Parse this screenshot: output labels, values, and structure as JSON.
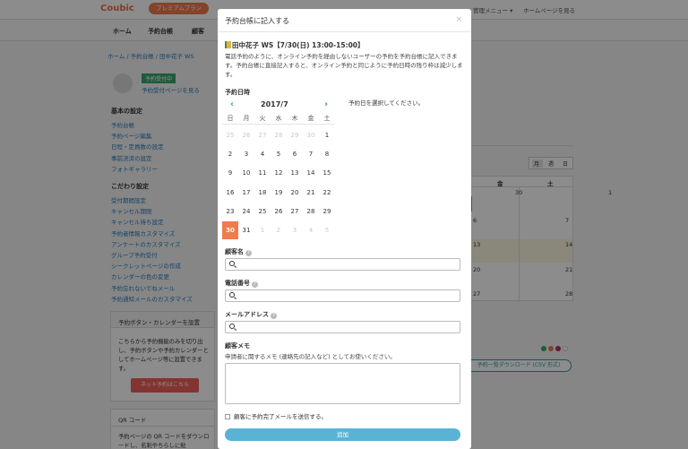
{
  "app": {
    "logo": "Coubic",
    "plan_badge": "プレミアムプラン",
    "menu": "管理メニュー ▾",
    "homepage": "ホームページを見る"
  },
  "nav": {
    "home": "ホーム",
    "reservation_book": "予約台帳",
    "customers": "顧客"
  },
  "breadcrumb": "ホーム / 予約台帳 / 田中花子 WS",
  "sidebar": {
    "status_badge": "予約受付中",
    "view_page": "予約受付ページを見る",
    "basic_title": "基本の設定",
    "basic_items": [
      "予約台帳",
      "予約ページ編集",
      "日程・定員数の設定",
      "事前決済の設定",
      "フォトギャラリー"
    ],
    "custom_title": "こだわり設定",
    "custom_items": [
      "受付期間設定",
      "キャンセル期限",
      "キャンセル待ち設定",
      "予約者情報カスタマイズ",
      "アンケートのカスタマイズ",
      "グループ予約受付",
      "シークレットページの作成",
      "カレンダーの色の変更",
      "予約忘れないでねメール",
      "予約通知メールのカスタマイズ"
    ],
    "widget_title": "予約ボタン・カレンダーを設置",
    "widget_text": "こちらから予約機能のみを切り出し、予約ボタンや予約カレンダーとしてホームページ等に設置できます。",
    "widget_button": "ネット予約はこちら",
    "qr_title": "QR コード",
    "qr_text": "予約ページの QR コードをダウンロードし、名刺やちらしに貼"
  },
  "bg_calendar": {
    "views": [
      "月",
      "週",
      "日"
    ],
    "days": [
      "金",
      "土"
    ],
    "nums": [
      "30",
      "1",
      "6",
      "7",
      "13",
      "14",
      "20",
      "21",
      "27",
      "28",
      "3",
      "4"
    ],
    "csv": "予約一覧ダウンロード (CSV 形式)"
  },
  "modal": {
    "title": "予約台帳に記入する",
    "close": "×",
    "event": "田中花子 WS【7/30(日) 13:00-15:00】",
    "description": "電話予約のように、オンライン予約を経由しないユーザーの予約を予約台帳に記入できます。予約台帳に直接記入すると、オンライン予約と同じように予約日時の残り枠は減少します。",
    "date_label": "予約日時",
    "month": "2017/7",
    "prev": "‹",
    "next": "›",
    "weekdays": [
      "日",
      "月",
      "火",
      "水",
      "木",
      "金",
      "土"
    ],
    "weeks": [
      [
        {
          "d": "25",
          "off": true
        },
        {
          "d": "26",
          "off": true
        },
        {
          "d": "27",
          "off": true
        },
        {
          "d": "28",
          "off": true
        },
        {
          "d": "29",
          "off": true
        },
        {
          "d": "30",
          "off": true
        },
        {
          "d": "1",
          "off": false
        }
      ],
      [
        {
          "d": "2"
        },
        {
          "d": "3"
        },
        {
          "d": "4"
        },
        {
          "d": "5"
        },
        {
          "d": "6"
        },
        {
          "d": "7"
        },
        {
          "d": "8"
        }
      ],
      [
        {
          "d": "9"
        },
        {
          "d": "10"
        },
        {
          "d": "11"
        },
        {
          "d": "12"
        },
        {
          "d": "13"
        },
        {
          "d": "14"
        },
        {
          "d": "15"
        }
      ],
      [
        {
          "d": "16"
        },
        {
          "d": "17"
        },
        {
          "d": "18"
        },
        {
          "d": "19"
        },
        {
          "d": "20"
        },
        {
          "d": "21"
        },
        {
          "d": "22"
        }
      ],
      [
        {
          "d": "23"
        },
        {
          "d": "24"
        },
        {
          "d": "25"
        },
        {
          "d": "26"
        },
        {
          "d": "27"
        },
        {
          "d": "28"
        },
        {
          "d": "29"
        }
      ],
      [
        {
          "d": "30",
          "sel": true
        },
        {
          "d": "31"
        },
        {
          "d": "1",
          "off": true
        },
        {
          "d": "2",
          "off": true
        },
        {
          "d": "3",
          "off": true
        },
        {
          "d": "4",
          "off": true
        },
        {
          "d": "5",
          "off": true
        }
      ]
    ],
    "pick_text": "予約日を選択してください。",
    "name_label": "顧客名",
    "phone_label": "電話番号",
    "email_label": "メールアドレス",
    "memo_label": "顧客メモ",
    "memo_help": "申請者に関するメモ (連絡先の記入など) としてお使いください。",
    "send_mail": "顧客に予約完了メールを送信する。",
    "add_button": "追加"
  }
}
